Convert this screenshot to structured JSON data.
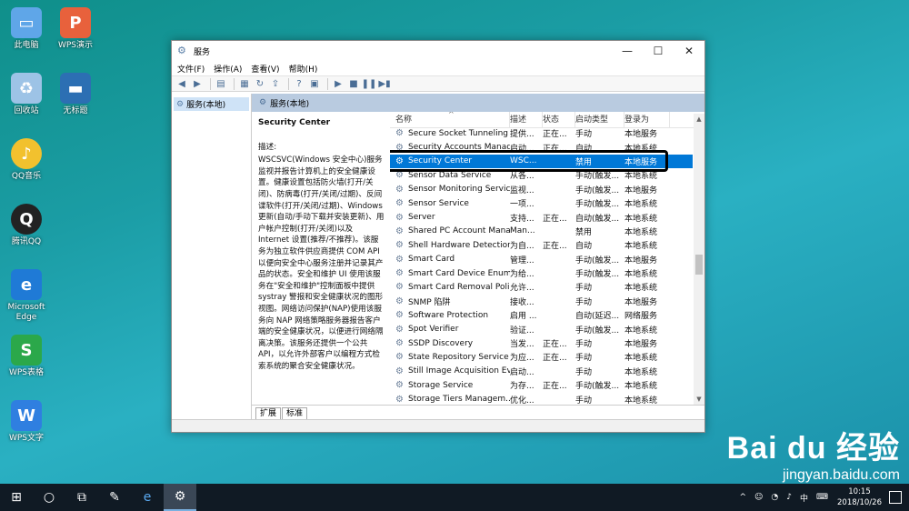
{
  "desktop": {
    "icons": [
      {
        "label": "此电脑",
        "icon": "computer-icon",
        "color": "#5fa6e8"
      },
      {
        "label": "WPS演示",
        "icon": "wps-presentation-icon",
        "color": "#e8613c"
      },
      {
        "label": "回收站",
        "icon": "recycle-bin-icon",
        "color": "#9dc3e6"
      },
      {
        "label": "无标题",
        "icon": "document-icon",
        "color": "#2c6fb3"
      },
      {
        "label": "QQ音乐",
        "icon": "qq-music-icon",
        "color": "#f2c12e"
      },
      {
        "label": "腾讯QQ",
        "icon": "qq-icon",
        "color": "#222222"
      },
      {
        "label": "Microsoft Edge",
        "icon": "edge-icon",
        "color": "#1f7ad6"
      },
      {
        "label": "WPS表格",
        "icon": "wps-spreadsheet-icon",
        "color": "#2ba84a"
      },
      {
        "label": "WPS文字",
        "icon": "wps-writer-icon",
        "color": "#2f7fe0"
      }
    ]
  },
  "window": {
    "title": "服务",
    "menu": [
      "文件(F)",
      "操作(A)",
      "查看(V)",
      "帮助(H)"
    ],
    "tree_node": "服务(本地)",
    "main_header": "服务(本地)",
    "selected_service": "Security Center",
    "description_label": "描述:",
    "description_text": "WSCSVC(Windows 安全中心)服务监视并报告计算机上的安全健康设置。健康设置包括防火墙(打开/关闭)、防病毒(打开/关闭/过期)、反间谍软件(打开/关闭/过期)、Windows 更新(自动/手动下载并安装更新)、用户帐户控制(打开/关闭)以及 Internet 设置(推荐/不推荐)。该服务为独立软件供应商提供 COM API 以便向安全中心服务注册并记录其产品的状态。安全和维护 UI 使用该服务在\"安全和维护\"控制面板中提供 systray 警报和安全健康状况的图形视图。网络访问保护(NAP)使用该服务向 NAP 网络策略服务器报告客户端的安全健康状况，以便进行网络隔离决策。该服务还提供一个公共 API，以允许外部客户以编程方式检索系统的聚合安全健康状况。",
    "columns": {
      "name": "名称",
      "desc": "描述",
      "status": "状态",
      "startup": "启动类型",
      "logon": "登录为"
    },
    "rows": [
      {
        "name": "Secure Socket Tunneling ...",
        "desc": "提供...",
        "status": "正在...",
        "startup": "手动",
        "logon": "本地服务"
      },
      {
        "name": "Security Accounts Manag...",
        "desc": "启动...",
        "status": "正在...",
        "startup": "自动",
        "logon": "本地系统"
      },
      {
        "name": "Security Center",
        "desc": "WSC...",
        "status": "",
        "startup": "禁用",
        "logon": "本地服务",
        "selected": true
      },
      {
        "name": "Sensor Data Service",
        "desc": "从各...",
        "status": "",
        "startup": "手动(触发...",
        "logon": "本地系统"
      },
      {
        "name": "Sensor Monitoring Service",
        "desc": "监视...",
        "status": "",
        "startup": "手动(触发...",
        "logon": "本地服务"
      },
      {
        "name": "Sensor Service",
        "desc": "一项...",
        "status": "",
        "startup": "手动(触发...",
        "logon": "本地系统"
      },
      {
        "name": "Server",
        "desc": "支持...",
        "status": "正在...",
        "startup": "自动(触发...",
        "logon": "本地系统"
      },
      {
        "name": "Shared PC Account Mana...",
        "desc": "Man...",
        "status": "",
        "startup": "禁用",
        "logon": "本地系统"
      },
      {
        "name": "Shell Hardware Detection",
        "desc": "为自...",
        "status": "正在...",
        "startup": "自动",
        "logon": "本地系统"
      },
      {
        "name": "Smart Card",
        "desc": "管理...",
        "status": "",
        "startup": "手动(触发...",
        "logon": "本地服务"
      },
      {
        "name": "Smart Card Device Enum...",
        "desc": "为给...",
        "status": "",
        "startup": "手动(触发...",
        "logon": "本地系统"
      },
      {
        "name": "Smart Card Removal Poli...",
        "desc": "允许...",
        "status": "",
        "startup": "手动",
        "logon": "本地系统"
      },
      {
        "name": "SNMP 陷阱",
        "desc": "接收...",
        "status": "",
        "startup": "手动",
        "logon": "本地服务"
      },
      {
        "name": "Software Protection",
        "desc": "启用 ...",
        "status": "",
        "startup": "自动(延迟...",
        "logon": "网络服务"
      },
      {
        "name": "Spot Verifier",
        "desc": "验证...",
        "status": "",
        "startup": "手动(触发...",
        "logon": "本地系统"
      },
      {
        "name": "SSDP Discovery",
        "desc": "当发...",
        "status": "正在...",
        "startup": "手动",
        "logon": "本地服务"
      },
      {
        "name": "State Repository Service",
        "desc": "为应...",
        "status": "正在...",
        "startup": "手动",
        "logon": "本地系统"
      },
      {
        "name": "Still Image Acquisition Ev...",
        "desc": "启动...",
        "status": "",
        "startup": "手动",
        "logon": "本地系统"
      },
      {
        "name": "Storage Service",
        "desc": "为存...",
        "status": "正在...",
        "startup": "手动(触发...",
        "logon": "本地系统"
      },
      {
        "name": "Storage Tiers Managem...",
        "desc": "优化...",
        "status": "",
        "startup": "手动",
        "logon": "本地系统"
      }
    ],
    "tabs": [
      "扩展",
      "标准"
    ]
  },
  "taskbar": {
    "time": "10:15",
    "date": "2018/10/26",
    "ime": "中"
  },
  "watermark": {
    "main": "Bai du 经验",
    "url": "jingyan.baidu.com"
  }
}
